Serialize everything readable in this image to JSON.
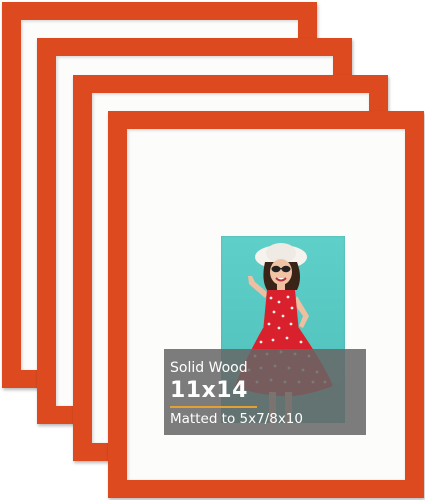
{
  "product_image": {
    "frame_color": "#dd4a1f",
    "mat_color": "#fcfcfb",
    "photo_background": "#58c8c1",
    "overlay": {
      "material_text": "Solid Wood",
      "size_text": "11x14",
      "matted_text": "Matted to 5x7/8x10",
      "underline_color": "#e3a033"
    }
  }
}
